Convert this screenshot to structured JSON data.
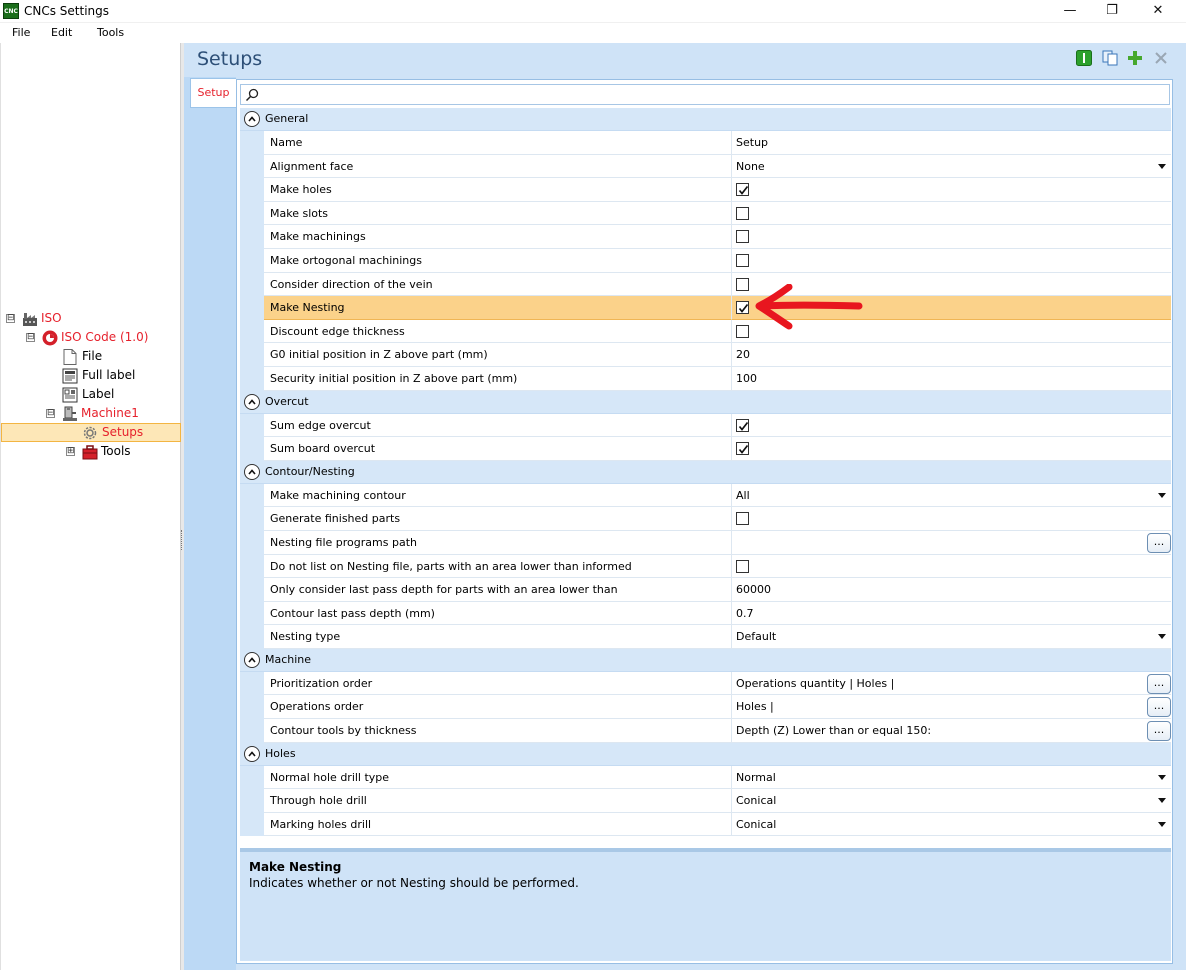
{
  "window": {
    "app_icon_text": "CNC",
    "title": "CNCs Settings",
    "min_glyph": "—",
    "max_glyph": "❐",
    "close_glyph": "✕"
  },
  "menu": [
    "File",
    "Edit",
    "Tools"
  ],
  "tree": {
    "root": {
      "label": "ISO",
      "toggle": "⊟"
    },
    "iso_code": {
      "label": "ISO Code (1.0)",
      "toggle": "⊟"
    },
    "file": {
      "label": "File"
    },
    "full_label": {
      "label": "Full label"
    },
    "label": {
      "label": "Label"
    },
    "machine": {
      "label": "Machine1",
      "toggle": "⊟"
    },
    "setups": {
      "label": "Setups"
    },
    "tools": {
      "label": "Tools",
      "toggle": "⊞"
    }
  },
  "page": {
    "title": "Setups",
    "tab": "Setup",
    "search_placeholder": ""
  },
  "groups": [
    {
      "name": "General",
      "rows": [
        {
          "name": "Name",
          "type": "text",
          "value": "Setup"
        },
        {
          "name": "Alignment face",
          "type": "dropdown",
          "value": "None"
        },
        {
          "name": "Make holes",
          "type": "checkbox",
          "checked": true
        },
        {
          "name": "Make slots",
          "type": "checkbox",
          "checked": false
        },
        {
          "name": "Make machinings",
          "type": "checkbox",
          "checked": false
        },
        {
          "name": "Make ortogonal machinings",
          "type": "checkbox",
          "checked": false
        },
        {
          "name": "Consider direction of the vein",
          "type": "checkbox",
          "checked": false
        },
        {
          "name": "Make Nesting",
          "type": "checkbox",
          "checked": true,
          "highlight": true
        },
        {
          "name": "Discount edge thickness",
          "type": "checkbox",
          "checked": false
        },
        {
          "name": "G0 initial position in Z above part (mm)",
          "type": "text",
          "value": "20"
        },
        {
          "name": "Security initial position in Z above part (mm)",
          "type": "text",
          "value": "100"
        }
      ]
    },
    {
      "name": "Overcut",
      "rows": [
        {
          "name": "Sum edge overcut",
          "type": "checkbox",
          "checked": true
        },
        {
          "name": "Sum board overcut",
          "type": "checkbox",
          "checked": true
        }
      ]
    },
    {
      "name": "Contour/Nesting",
      "rows": [
        {
          "name": "Make machining contour",
          "type": "dropdown",
          "value": "All"
        },
        {
          "name": "Generate finished parts",
          "type": "checkbox",
          "checked": false
        },
        {
          "name": "Nesting file programs path",
          "type": "ellipsis",
          "value": ""
        },
        {
          "name": "Do not list on Nesting file, parts with an area lower than informed",
          "type": "checkbox",
          "checked": false
        },
        {
          "name": "Only consider last pass depth for parts with an area lower than",
          "type": "text",
          "value": "60000"
        },
        {
          "name": "Contour last pass depth (mm)",
          "type": "text",
          "value": "0.7"
        },
        {
          "name": "Nesting type",
          "type": "dropdown",
          "value": "Default"
        }
      ]
    },
    {
      "name": "Machine",
      "rows": [
        {
          "name": "Prioritization order",
          "type": "ellipsis",
          "value": "Operations quantity | Holes |"
        },
        {
          "name": "Operations order",
          "type": "ellipsis",
          "value": "Holes |"
        },
        {
          "name": "Contour tools by thickness",
          "type": "ellipsis",
          "value": "Depth (Z) Lower than or equal 150:"
        }
      ]
    },
    {
      "name": "Holes",
      "rows": [
        {
          "name": "Normal hole drill type",
          "type": "dropdown",
          "value": "Normal"
        },
        {
          "name": "Through hole drill",
          "type": "dropdown",
          "value": "Conical"
        },
        {
          "name": "Marking holes drill",
          "type": "dropdown",
          "value": "Conical"
        }
      ]
    }
  ],
  "ellipsis_label": "...",
  "description": {
    "title": "Make Nesting",
    "text": "Indicates whether or not Nesting should be performed."
  },
  "colors": {
    "accent_red": "#e6212c",
    "highlight": "#fbd28a",
    "panel_blue": "#cfe3f7",
    "title_blue": "#2d4f77"
  }
}
